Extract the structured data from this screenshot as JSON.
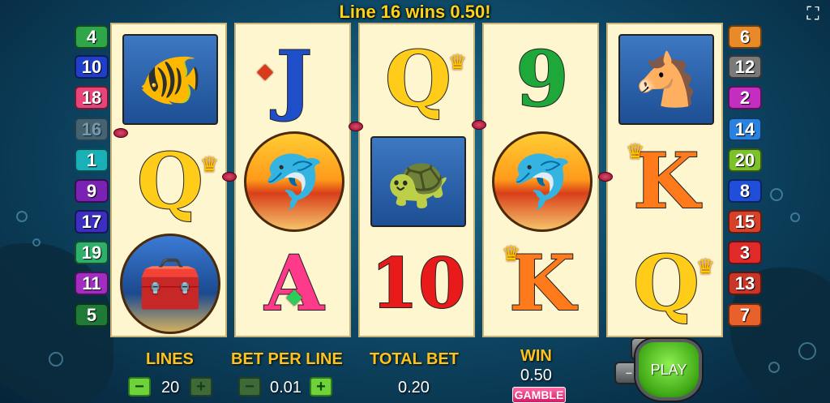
{
  "banner": "Line 16 wins 0.50!",
  "icons": {
    "fullscreen": "fullscreen-icon",
    "angelfish": "angelfish-icon",
    "seahorse": "seahorse-icon",
    "dolphin": "dolphin-icon",
    "turtle": "turtle-icon",
    "treasure": "treasure-chest-icon",
    "crown": "crown-icon",
    "gem": "gem-icon",
    "shield": "shield-icon"
  },
  "reels": [
    [
      "angelfish",
      "Q",
      "treasure-chest"
    ],
    [
      "J",
      "dolphin",
      "A"
    ],
    [
      "Q",
      "turtle",
      "10"
    ],
    [
      "9",
      "dolphin",
      "K"
    ],
    [
      "seahorse",
      "K",
      "Q"
    ]
  ],
  "left_lines": [
    "4",
    "10",
    "18",
    "16",
    "1",
    "9",
    "17",
    "19",
    "11",
    "5"
  ],
  "right_lines": [
    "6",
    "12",
    "2",
    "14",
    "20",
    "8",
    "15",
    "3",
    "13",
    "7"
  ],
  "hud": {
    "lines_label": "LINES",
    "lines_value": "20",
    "bet_label": "BET PER LINE",
    "bet_value": "0.01",
    "total_label": "TOTAL BET",
    "total_value": "0.20",
    "win_label": "WIN",
    "win_value": "0.50",
    "gamble_label": "GAMBLE",
    "play_label": "PLAY",
    "minus": "−",
    "plus": "+",
    "small_plus": "+",
    "small_minus": "−"
  },
  "colors": {
    "banner": "#ffd21a",
    "hud_label": "#ffc21a",
    "play": "#3ea814",
    "gamble": "#d21a66"
  }
}
